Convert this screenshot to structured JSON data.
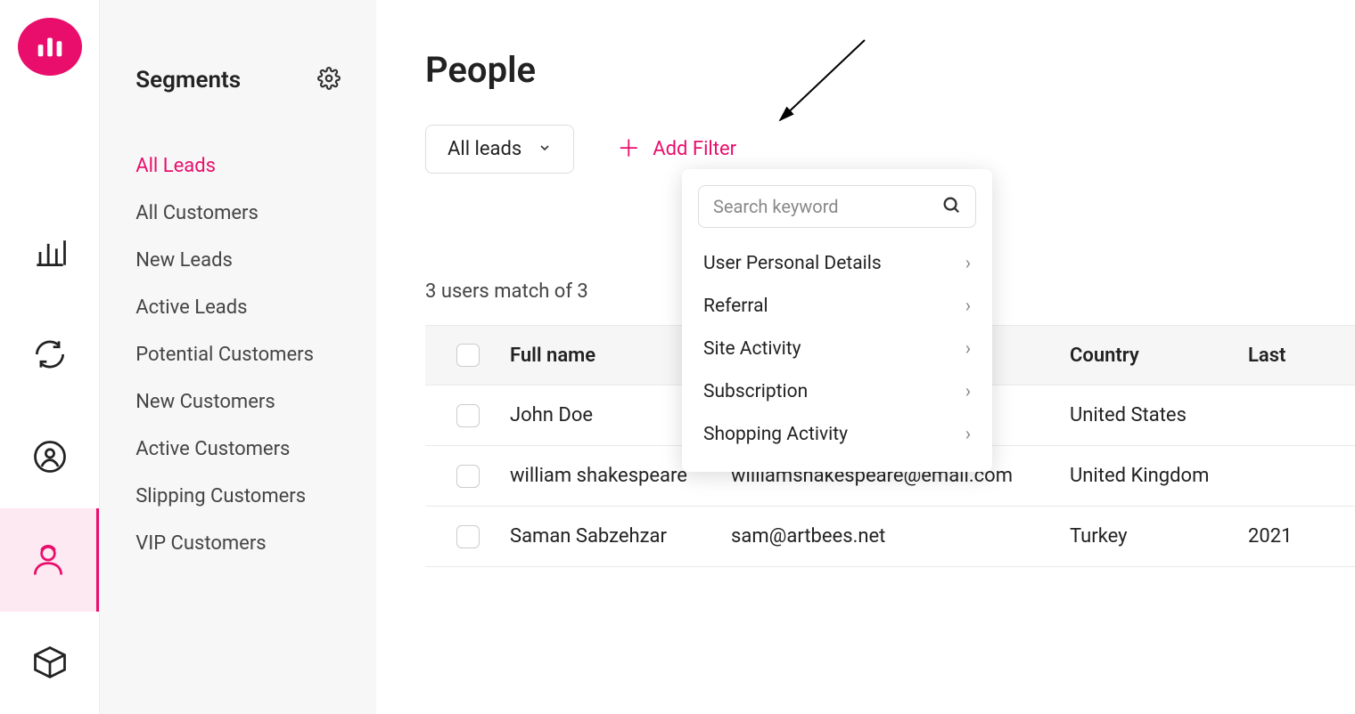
{
  "sidebar": {
    "title": "Segments",
    "items": [
      {
        "label": "All Leads",
        "active": true
      },
      {
        "label": "All Customers"
      },
      {
        "label": "New Leads"
      },
      {
        "label": "Active Leads"
      },
      {
        "label": "Potential Customers"
      },
      {
        "label": "New Customers"
      },
      {
        "label": "Active Customers"
      },
      {
        "label": "Slipping Customers"
      },
      {
        "label": "VIP Customers"
      }
    ]
  },
  "page": {
    "title": "People",
    "dropdown_label": "All leads",
    "add_filter_label": "Add Filter",
    "count_text": "3 users match of 3"
  },
  "filter_popover": {
    "search_placeholder": "Search keyword",
    "categories": [
      "User Personal Details",
      "Referral",
      "Site Activity",
      "Subscription",
      "Shopping Activity"
    ]
  },
  "table": {
    "columns": [
      "Full name",
      "",
      "Country",
      "Last"
    ],
    "rows": [
      {
        "name": "John Doe",
        "email": "",
        "country": "United States",
        "last": ""
      },
      {
        "name": "william shakespeare",
        "email": "williamshakespeare@email.com",
        "country": "United Kingdom",
        "last": ""
      },
      {
        "name": "Saman Sabzehzar",
        "email": "sam@artbees.net",
        "country": "Turkey",
        "last": "2021"
      }
    ]
  }
}
